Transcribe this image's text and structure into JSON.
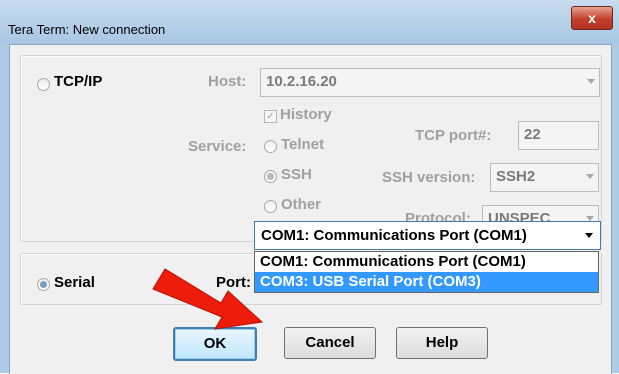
{
  "window": {
    "title": "Tera Term: New connection",
    "close_label": "x"
  },
  "tcpip": {
    "label": "TCP/IP",
    "host_label": "Host:",
    "host_value": "10.2.16.20",
    "history_label": "History",
    "service_label": "Service:",
    "services": [
      "Telnet",
      "SSH",
      "Other"
    ],
    "tcp_port_label": "TCP port#:",
    "tcp_port_value": "22",
    "ssh_version_label": "SSH version:",
    "ssh_version_value": "SSH2",
    "protocol_label": "Protocol:",
    "protocol_value": "UNSPEC"
  },
  "serial": {
    "label": "Serial",
    "port_label": "Port:",
    "port_value": "COM1: Communications Port (COM1)",
    "options": [
      "COM1: Communications Port (COM1)",
      "COM3: USB Serial Port (COM3)"
    ]
  },
  "buttons": {
    "ok": "OK",
    "cancel": "Cancel",
    "help": "Help"
  },
  "annotation": {
    "arrow_color": "#ee1c0b"
  }
}
